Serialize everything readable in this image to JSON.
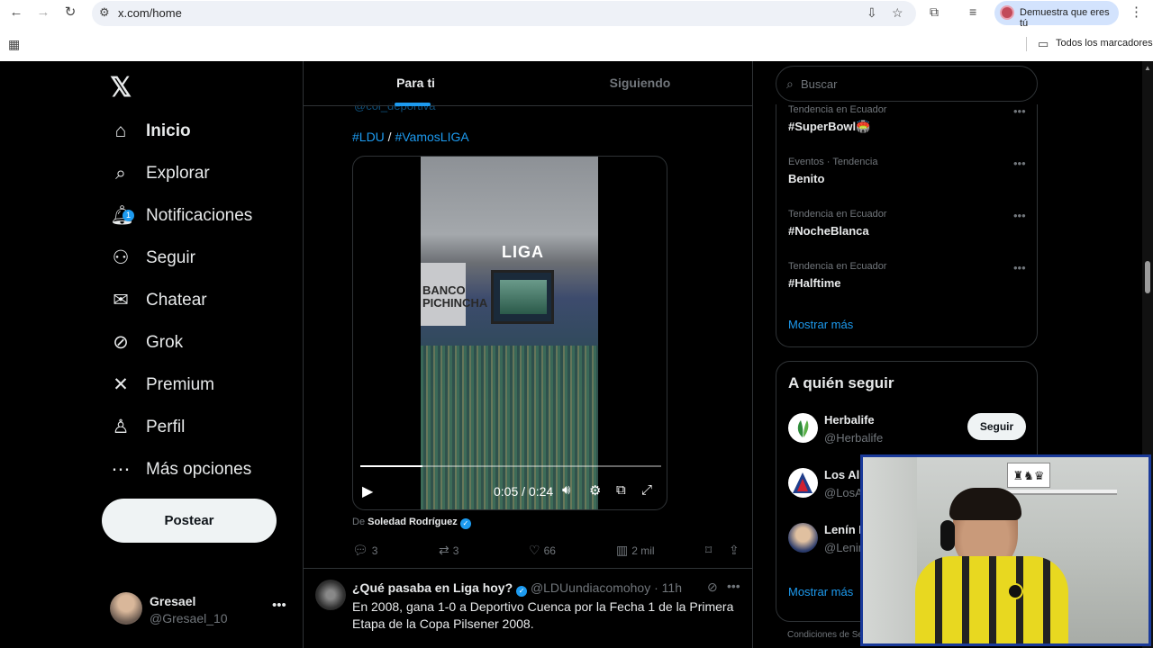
{
  "browser": {
    "url": "x.com/home",
    "profile_chip": "Demuestra que eres tú",
    "bookmarks_all": "Todos los marcadores"
  },
  "sidebar": {
    "logo": "𝕏",
    "items": [
      {
        "label": "Inicio",
        "icon": "home-icon"
      },
      {
        "label": "Explorar",
        "icon": "search-icon"
      },
      {
        "label": "Notificaciones",
        "icon": "bell-icon",
        "badge": "1"
      },
      {
        "label": "Seguir",
        "icon": "add-person-icon"
      },
      {
        "label": "Chatear",
        "icon": "mail-icon"
      },
      {
        "label": "Grok",
        "icon": "grok-icon"
      },
      {
        "label": "Premium",
        "icon": "x-icon"
      },
      {
        "label": "Perfil",
        "icon": "person-icon"
      },
      {
        "label": "Más opciones",
        "icon": "more-circle-icon"
      }
    ],
    "post_button": "Postear",
    "account": {
      "name": "Gresael",
      "handle": "@Gresael_10"
    }
  },
  "main": {
    "tabs": [
      "Para ti",
      "Siguiendo"
    ],
    "tweet1": {
      "cut_handle": "@col_deportiva",
      "hashtag1": "#LDU",
      "separator": " / ",
      "hashtag2": "#VamosLIGA",
      "video": {
        "current_time": "0:05",
        "duration": "0:24",
        "time_display": "0:05 / 0:24",
        "progress": 0.208,
        "scoreboard_text": "LIGA",
        "banner_text": "BANCO\nPICHINCHA"
      },
      "from_prefix": "De",
      "from_name": "Soledad Rodríguez",
      "stats": {
        "replies": "3",
        "reposts": "3",
        "likes": "66",
        "views": "2 mil"
      }
    },
    "tweet2": {
      "name": "¿Qué pasaba en Liga hoy?",
      "handle": "@LDUundiacomohoy",
      "time": "· 11h",
      "text": "En 2008, gana 1-0 a Deportivo Cuenca por la Fecha 1 de la Primera Etapa de la Copa Pilsener 2008."
    }
  },
  "right": {
    "search_placeholder": "Buscar",
    "trends": [
      {
        "meta": "Tendencia en Ecuador",
        "name": "#SuperBowl🏟️"
      },
      {
        "meta": "Eventos · Tendencia",
        "name": "Benito"
      },
      {
        "meta": "Tendencia en Ecuador",
        "name": "#NocheBlanca"
      },
      {
        "meta": "Tendencia en Ecuador",
        "name": "#Halftime"
      }
    ],
    "show_more": "Mostrar más",
    "who_to_follow_title": "A quién seguir",
    "follow_users": [
      {
        "name": "Herbalife",
        "handle": "@Herbalife",
        "button": "Seguir"
      },
      {
        "name": "Los All",
        "handle": "@LosA"
      },
      {
        "name": "Lenín I",
        "handle": "@Lenin"
      }
    ],
    "show_more_2": "Mostrar más",
    "footer": "Condiciones de Se"
  },
  "colors": {
    "accent": "#1d9bf0",
    "background": "#000000",
    "border": "#2f3336",
    "muted": "#71767b"
  }
}
